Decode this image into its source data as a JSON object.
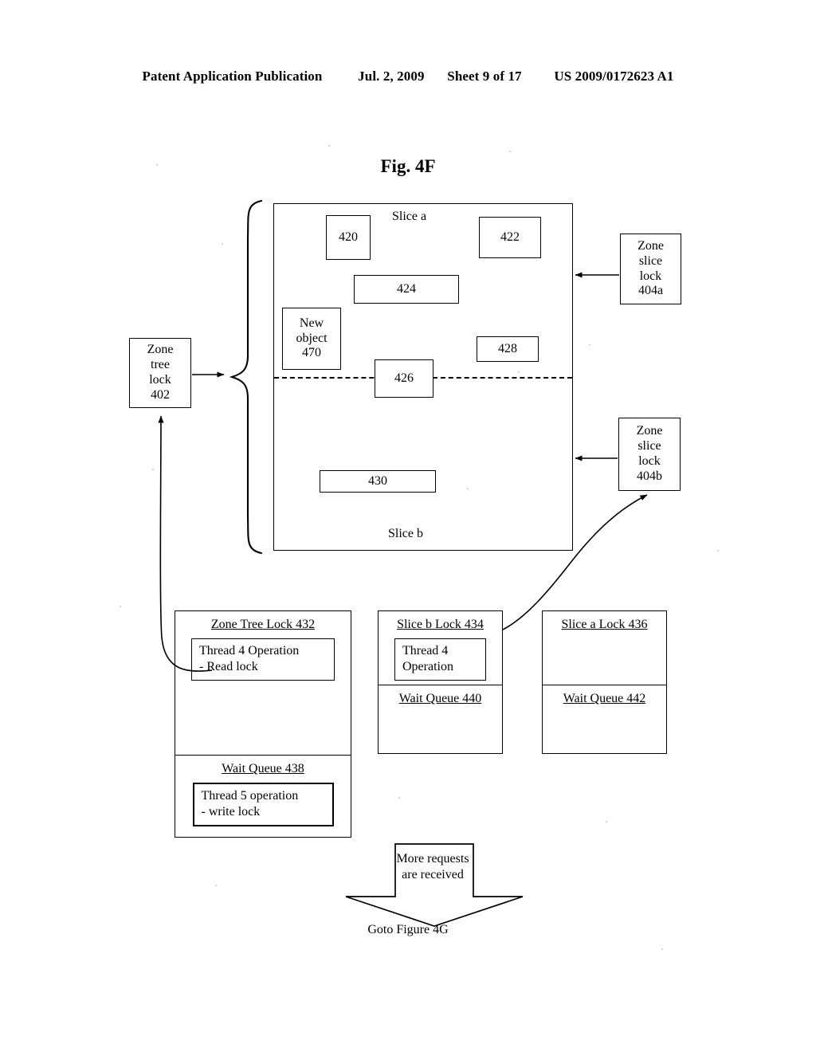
{
  "header": {
    "publication": "Patent Application Publication",
    "date": "Jul. 2, 2009",
    "sheet": "Sheet 9 of 17",
    "patent_number": "US 2009/0172623 A1"
  },
  "figure": {
    "title": "Fig. 4F"
  },
  "zone": {
    "slice_a_label": "Slice a",
    "slice_b_label": "Slice b",
    "nodes": [
      {
        "id": "node-420",
        "label": "420"
      },
      {
        "id": "node-422",
        "label": "422"
      },
      {
        "id": "node-424",
        "label": "424"
      },
      {
        "id": "node-426",
        "label": "426"
      },
      {
        "id": "node-428",
        "label": "428"
      },
      {
        "id": "node-430",
        "label": "430"
      }
    ],
    "new_object": "New object 470",
    "new_object_lines": [
      "New",
      "object",
      "470"
    ]
  },
  "locks": {
    "zone_tree_lock": {
      "lines": [
        "Zone",
        "tree",
        "lock",
        "402"
      ],
      "label": "Zone tree lock 402"
    },
    "zone_slice_lock_a": {
      "lines": [
        "Zone",
        "slice",
        "lock",
        "404a"
      ],
      "label": "Zone slice lock 404a"
    },
    "zone_slice_lock_b": {
      "lines": [
        "Zone",
        "slice",
        "lock",
        "404b"
      ],
      "label": "Zone slice lock 404b"
    }
  },
  "lock_tables": [
    {
      "id": "zone-tree-lock-432",
      "title": "Zone Tree Lock 432",
      "holder": "Thread 4 Operation\n- Read lock",
      "holder_lines": [
        "Thread 4 Operation",
        "- Read lock"
      ],
      "wait_queue_title": "Wait Queue 438",
      "wait_queue_entry_lines": [
        "Thread 5 operation",
        "- write lock"
      ]
    },
    {
      "id": "slice-b-lock-434",
      "title": "Slice b Lock 434",
      "holder_lines": [
        "Thread 4",
        "Operation"
      ],
      "wait_queue_title": "Wait Queue 440",
      "wait_queue_entry_lines": []
    },
    {
      "id": "slice-a-lock-436",
      "title": "Slice a Lock 436",
      "holder_lines": [],
      "wait_queue_title": "Wait Queue 442",
      "wait_queue_entry_lines": []
    }
  ],
  "flow": {
    "more_requests_lines": [
      "More requests",
      "are received"
    ],
    "more_requests": "More requests are received",
    "goto": "Goto Figure 4G"
  },
  "colors": {
    "ink": "#000000",
    "page": "#ffffff"
  }
}
